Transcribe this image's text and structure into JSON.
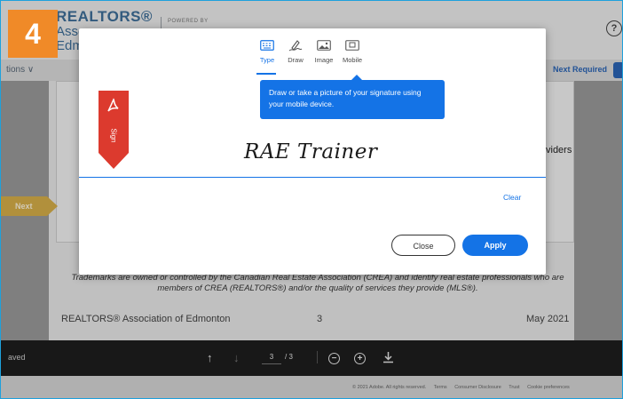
{
  "step_badge": "4",
  "background": {
    "logo_line1": "REALTORS®",
    "logo_line2": "Asso",
    "logo_line3": "Edm",
    "powered_by": "POWERED BY",
    "options": "tions ∨",
    "next_required": "Next Required",
    "providers_text": "viders",
    "next_tag": "Next",
    "trademark": "Trademarks are owned or controlled by the Canadian Real Estate Association (CREA) and identify real estate professionals who are members of CREA (REALTORS®) and/or the quality of services they provide (MLS®).",
    "footer_org": "REALTORS® Association of Edmonton",
    "footer_page": "3",
    "footer_date": "May 2021"
  },
  "modal": {
    "tabs": [
      {
        "label": "Type",
        "icon": "keyboard-icon",
        "active": true
      },
      {
        "label": "Draw",
        "icon": "pen-icon",
        "active": false
      },
      {
        "label": "Image",
        "icon": "image-icon",
        "active": false
      },
      {
        "label": "Mobile",
        "icon": "mobile-icon",
        "active": false
      }
    ],
    "tooltip": "Draw or take a picture of your signature using your mobile device.",
    "sign_flag": "Sign",
    "signature_value": "RAE Trainer",
    "clear_label": "Clear",
    "close_label": "Close",
    "apply_label": "Apply"
  },
  "controls": {
    "saved_text": "aved",
    "current_page": "3",
    "total_pages": "/ 3"
  },
  "bottom_links": [
    "© 2021 Adobe. All rights reserved.",
    "Terms",
    "Consumer Disclosure",
    "Trust",
    "Cookie preferences"
  ],
  "colors": {
    "accent": "#1473e6",
    "step_badge": "#f08a28",
    "sign_flag": "#dc3a2e",
    "next_tag": "#d8b04a"
  }
}
